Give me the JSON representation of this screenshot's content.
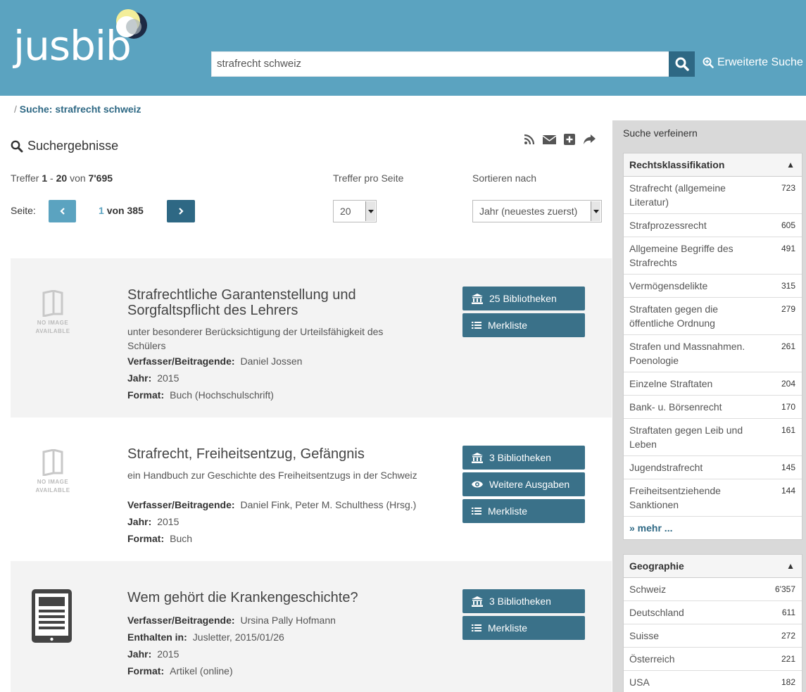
{
  "header": {
    "logo": "jusbib",
    "search_value": "strafrecht schweiz",
    "advanced_search": "Erweiterte Suche"
  },
  "breadcrumb": {
    "sep": "/",
    "label": "Suche: strafrecht schweiz"
  },
  "results": {
    "title": "Suchergebnisse",
    "hits_prefix": "Treffer",
    "hits_from": "1",
    "hits_dash": "-",
    "hits_to": "20",
    "hits_of": "von",
    "hits_total": "7'695",
    "hpp_label": "Treffer pro Seite",
    "hpp_value": "20",
    "sort_label": "Sortieren nach",
    "sort_value": "Jahr (neuestes zuerst)",
    "page_label": "Seite:",
    "page_current": "1",
    "page_of": "von 385"
  },
  "noimage": {
    "line1": "NO IMAGE",
    "line2": "AVAILABLE"
  },
  "items": [
    {
      "title": "Strafrechtliche Garantenstellung und Sorgfaltspflicht des Lehrers",
      "subtitle": "unter besonderer Berücksichtigung der Urteilsfähigkeit des Schülers",
      "author_label": "Verfasser/Beitragende:",
      "author": "Daniel Jossen",
      "year_label": "Jahr:",
      "year": "2015",
      "format_label": "Format:",
      "format": "Buch (Hochschulschrift)",
      "btn_libraries": "25 Bibliotheken",
      "btn_list": "Merkliste"
    },
    {
      "title": "Strafrecht, Freiheitsentzug, Gefängnis",
      "subtitle": "ein Handbuch zur Geschichte des Freiheitsentzugs in der Schweiz",
      "author_label": "Verfasser/Beitragende:",
      "author": "Daniel Fink, Peter M. Schulthess (Hrsg.)",
      "year_label": "Jahr:",
      "year": "2015",
      "format_label": "Format:",
      "format": "Buch",
      "btn_libraries": "3 Bibliotheken",
      "btn_editions": "Weitere Ausgaben",
      "btn_list": "Merkliste"
    },
    {
      "title": "Wem gehört die Krankengeschichte?",
      "author_label": "Verfasser/Beitragende:",
      "author": "Ursina Pally Hofmann",
      "contained_label": "Enthalten in:",
      "contained": "Jusletter, 2015/01/26",
      "year_label": "Jahr:",
      "year": "2015",
      "format_label": "Format:",
      "format": "Artikel (online)",
      "btn_libraries": "3 Bibliotheken",
      "btn_list": "Merkliste"
    }
  ],
  "sidebar": {
    "title": "Suche verfeinern",
    "facet1": {
      "title": "Rechtsklassifikation",
      "items": [
        {
          "label": "Strafrecht (allgemeine Literatur)",
          "count": "723"
        },
        {
          "label": "Strafprozessrecht",
          "count": "605"
        },
        {
          "label": "Allgemeine Begriffe des Strafrechts",
          "count": "491"
        },
        {
          "label": "Vermögensdelikte",
          "count": "315"
        },
        {
          "label": "Straftaten gegen die öffentliche Ordnung",
          "count": "279"
        },
        {
          "label": "Strafen und Massnahmen. Poenologie",
          "count": "261"
        },
        {
          "label": "Einzelne Straftaten",
          "count": "204"
        },
        {
          "label": "Bank- u. Börsenrecht",
          "count": "170"
        },
        {
          "label": "Straftaten gegen Leib und Leben",
          "count": "161"
        },
        {
          "label": "Jugendstrafrecht",
          "count": "145"
        },
        {
          "label": "Freiheitsentziehende Sanktionen",
          "count": "144"
        }
      ],
      "more": "» mehr ..."
    },
    "facet2": {
      "title": "Geographie",
      "items": [
        {
          "label": "Schweiz",
          "count": "6'357"
        },
        {
          "label": "Deutschland",
          "count": "611"
        },
        {
          "label": "Suisse",
          "count": "272"
        },
        {
          "label": "Österreich",
          "count": "221"
        },
        {
          "label": "USA",
          "count": "182"
        }
      ]
    }
  }
}
